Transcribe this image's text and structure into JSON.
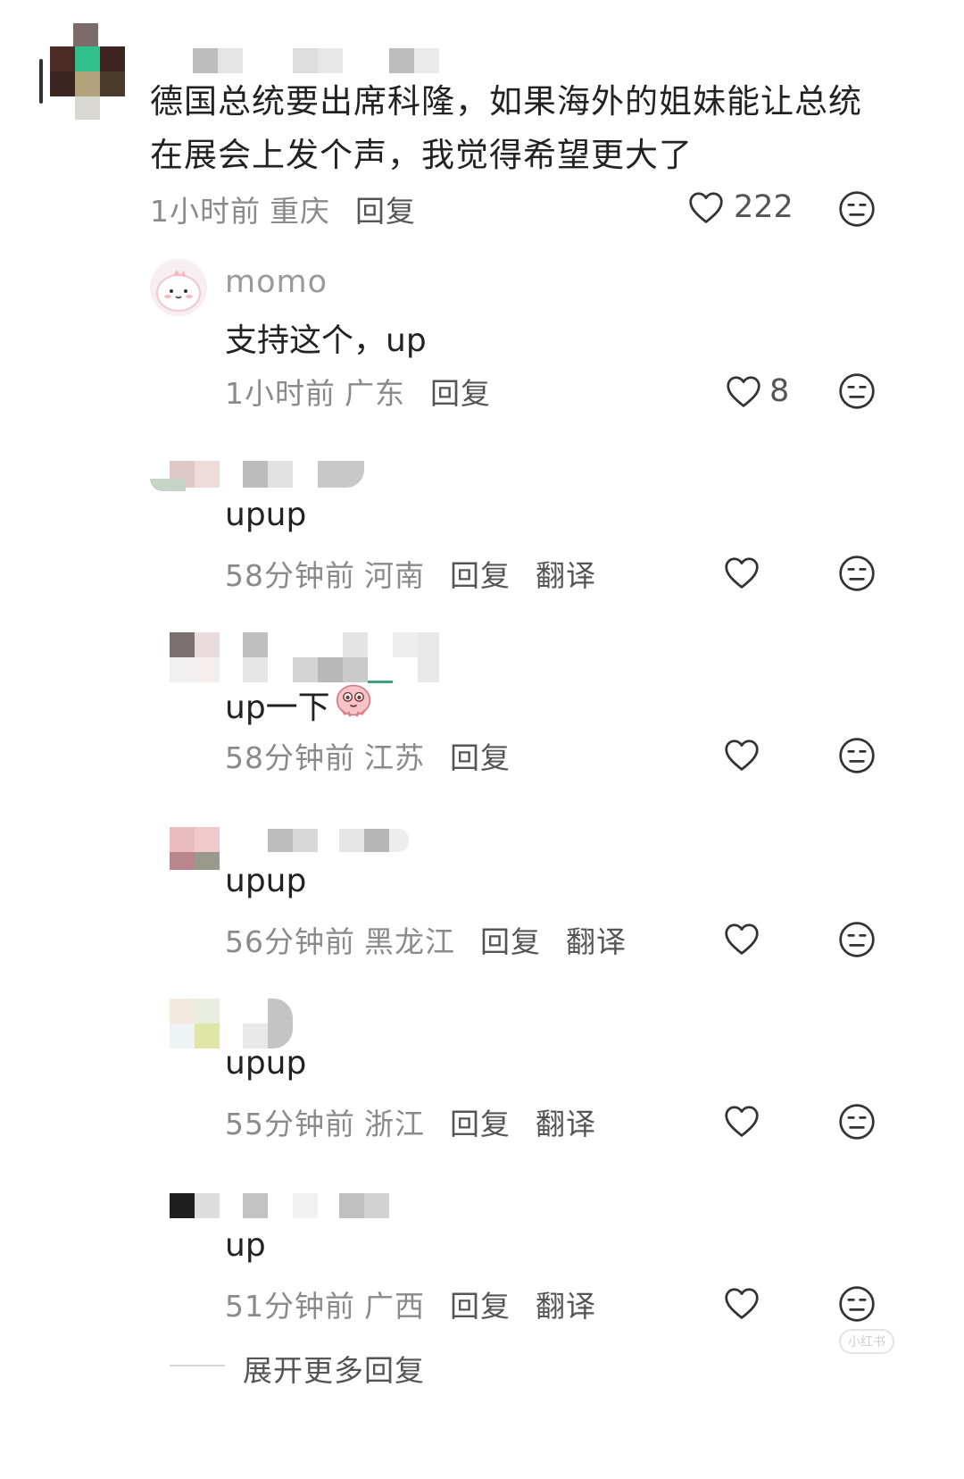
{
  "thread": {
    "main": {
      "text": "德国总统要出席科隆，如果海外的姐妹能让总统在展会上发个声，我觉得希望更大了",
      "time": "1小时前",
      "location": "重庆",
      "reply_label": "回复",
      "likes": "222"
    },
    "replies": [
      {
        "username": "momo",
        "text": "支持这个，up",
        "time": "1小时前",
        "location": "广东",
        "reply_label": "回复",
        "likes": "8"
      },
      {
        "text": "upup",
        "time": "58分钟前",
        "location": "河南",
        "reply_label": "回复",
        "translate_label": "翻译"
      },
      {
        "text": "up一下",
        "time": "58分钟前",
        "location": "江苏",
        "reply_label": "回复"
      },
      {
        "text": "upup",
        "time": "56分钟前",
        "location": "黑龙江",
        "reply_label": "回复",
        "translate_label": "翻译"
      },
      {
        "text": "upup",
        "time": "55分钟前",
        "location": "浙江",
        "reply_label": "回复",
        "translate_label": "翻译"
      },
      {
        "text": "up",
        "time": "51分钟前",
        "location": "广西",
        "reply_label": "回复",
        "translate_label": "翻译"
      }
    ],
    "expand_label": "展开更多回复"
  },
  "icons": {
    "like": "heart-outline-icon",
    "dislike": "neutral-face-icon"
  },
  "watermark": "小红书",
  "colors": {
    "text": "#222222",
    "meta": "#8a8a8a",
    "icon": "#333333"
  }
}
